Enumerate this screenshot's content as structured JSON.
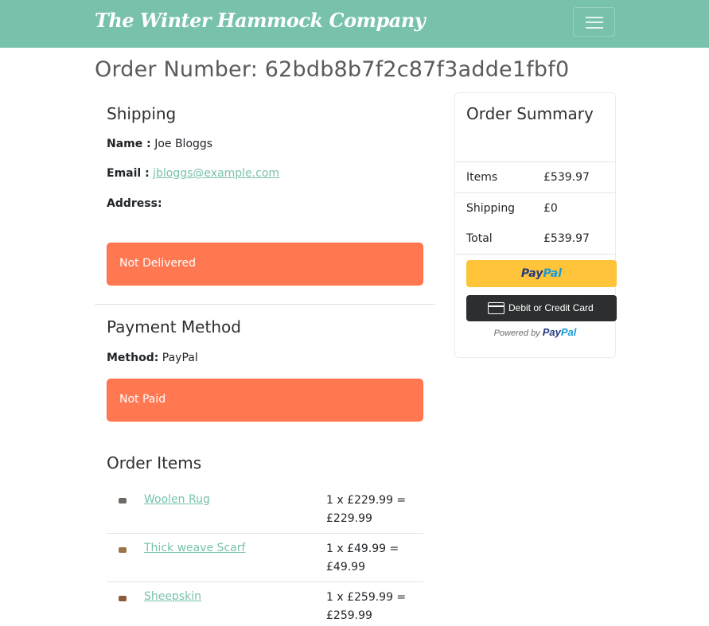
{
  "navbar": {
    "brand": "The Winter Hammock Company",
    "toggler_icon": "hamburger-menu-icon",
    "background": "#78c2ad"
  },
  "order": {
    "title": "Order Number: 62bdb8b7f2c87f3adde1fbf0"
  },
  "shipping": {
    "heading": "Shipping",
    "name_label": "Name :",
    "name_value": "Joe Bloggs",
    "email_label": "Email :",
    "email_value": "jbloggs@example.com",
    "address_label": "Address:",
    "delivery_status": "Not Delivered"
  },
  "payment": {
    "heading": "Payment Method",
    "method_label": "Method:",
    "method_value": "PayPal",
    "payment_status": "Not Paid"
  },
  "order_items": {
    "heading": "Order Items",
    "items": [
      {
        "name": "Woolen Rug",
        "price_line1": "1 x £229.99 =",
        "price_line2": "£229.99"
      },
      {
        "name": "Thick weave Scarf",
        "price_line1": "1 x £49.99 =",
        "price_line2": "£49.99"
      },
      {
        "name": "Sheepskin",
        "price_line1": "1 x £259.99 =",
        "price_line2": "£259.99"
      }
    ]
  },
  "summary": {
    "heading": "Order Summary",
    "rows": [
      {
        "label": "Items",
        "value": "£539.97"
      },
      {
        "label": "Shipping",
        "value": "£0"
      },
      {
        "label": "Total",
        "value": "£539.97"
      }
    ],
    "paypal_pay": "Pay",
    "paypal_pal": "Pal",
    "card_button": "Debit or Credit Card",
    "powered_by": "Powered by",
    "powered_pay": "Pay",
    "powered_pal": "Pal"
  },
  "colors": {
    "accent": "#78c2ad",
    "alert": "#ff7851",
    "paypal_yellow": "#ffc439",
    "card_dark": "#2c2e2f"
  }
}
